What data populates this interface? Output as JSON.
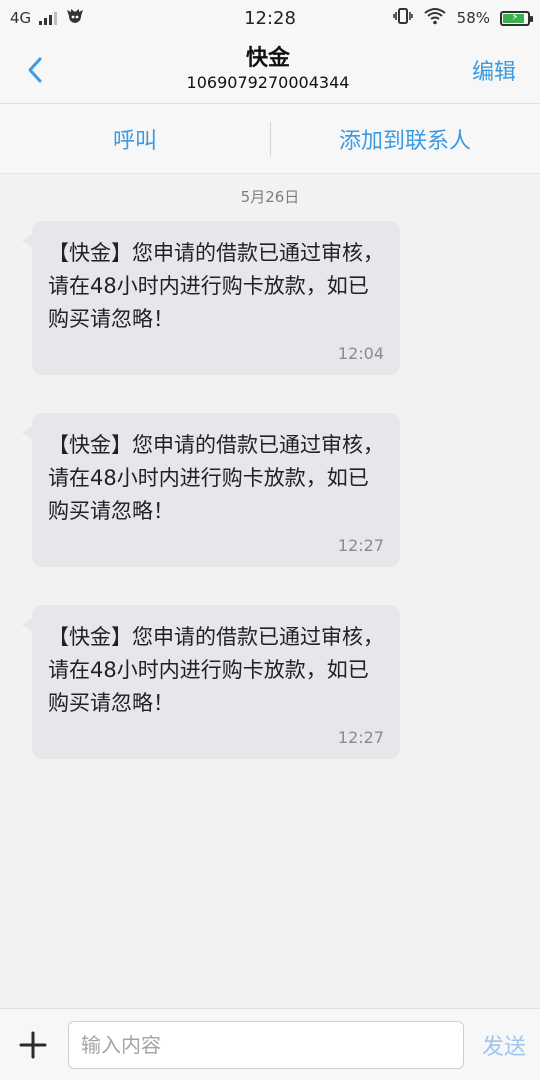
{
  "status_bar": {
    "network": "4G",
    "time": "12:28",
    "battery_percent": "58%",
    "icons": [
      "signal-icon",
      "app-icon",
      "vibrate-icon",
      "wifi-icon",
      "battery-icon"
    ]
  },
  "header": {
    "title": "快金",
    "subtitle": "1069079270004344",
    "edit_label": "编辑",
    "back_icon": "chevron-left-icon"
  },
  "actions": {
    "call_label": "呼叫",
    "add_contact_label": "添加到联系人"
  },
  "messages": {
    "date": "5月26日",
    "items": [
      {
        "text": "【快金】您申请的借款已通过审核，请在48小时内进行购卡放款，如已购买请忽略！",
        "time": "12:04"
      },
      {
        "text": "【快金】您申请的借款已通过审核，请在48小时内进行购卡放款，如已购买请忽略！",
        "time": "12:27"
      },
      {
        "text": "【快金】您申请的借款已通过审核，请在48小时内进行购卡放款，如已购买请忽略！",
        "time": "12:27"
      }
    ]
  },
  "input_bar": {
    "placeholder": "输入内容",
    "send_label": "发送",
    "plus_icon": "plus-icon"
  },
  "colors": {
    "accent": "#3a9be3",
    "bubble": "#e6e7ea",
    "background": "#f2f2f2"
  }
}
